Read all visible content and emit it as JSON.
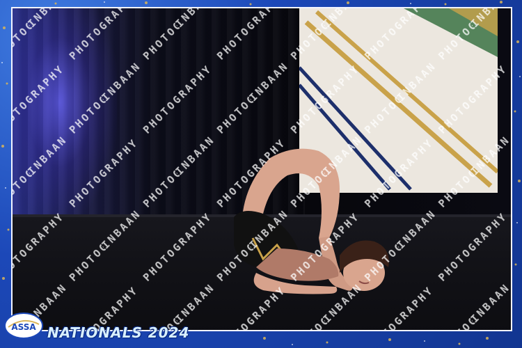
{
  "event": {
    "logo_text": "ASSA",
    "title": "NATIONALS 2024"
  },
  "watermark": {
    "text": "INBAAN PHOTOGRAPHY",
    "color": "#ffffff"
  },
  "colors": {
    "frame_blue": "#1c48b8",
    "frame_gold": "#d9b55a",
    "banner": "#ece7df",
    "banner_gold_stripe": "#c9a24a",
    "banner_navy_stripe": "#1d2f6b"
  },
  "scene": {
    "subject": "dancer-backbend-pose",
    "costume_colors": [
      "#111111",
      "#c9a24a"
    ]
  }
}
